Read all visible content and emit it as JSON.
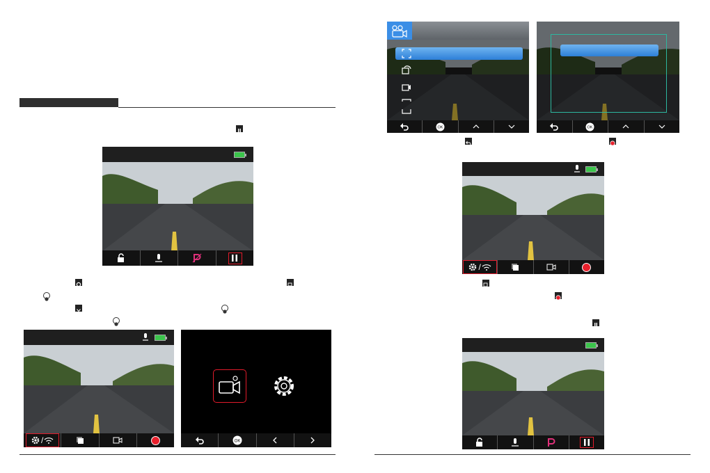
{
  "colors": {
    "highlight_red": "#e21b2b",
    "battery_green": "#3bc44b",
    "menu_blue": "#3b8ee6",
    "frame_teal": "#2db8a0",
    "section_bar": "#2f2f2f"
  },
  "icons": {
    "pause": "pause-icon",
    "gear": "gear-icon",
    "menu_mode": "mode-icon",
    "ok": "ok-icon",
    "down": "chevron-down-icon",
    "back": "back-icon",
    "record": "record-icon",
    "lock": "lock-icon",
    "mic": "microphone-icon",
    "parking": "parking-icon",
    "wifi": "wifi-icon",
    "photo": "photo-icon",
    "camera": "camera-icon"
  },
  "screens": {
    "paused": {
      "buttons": [
        "OK"
      ]
    },
    "ok_label": "OK"
  }
}
